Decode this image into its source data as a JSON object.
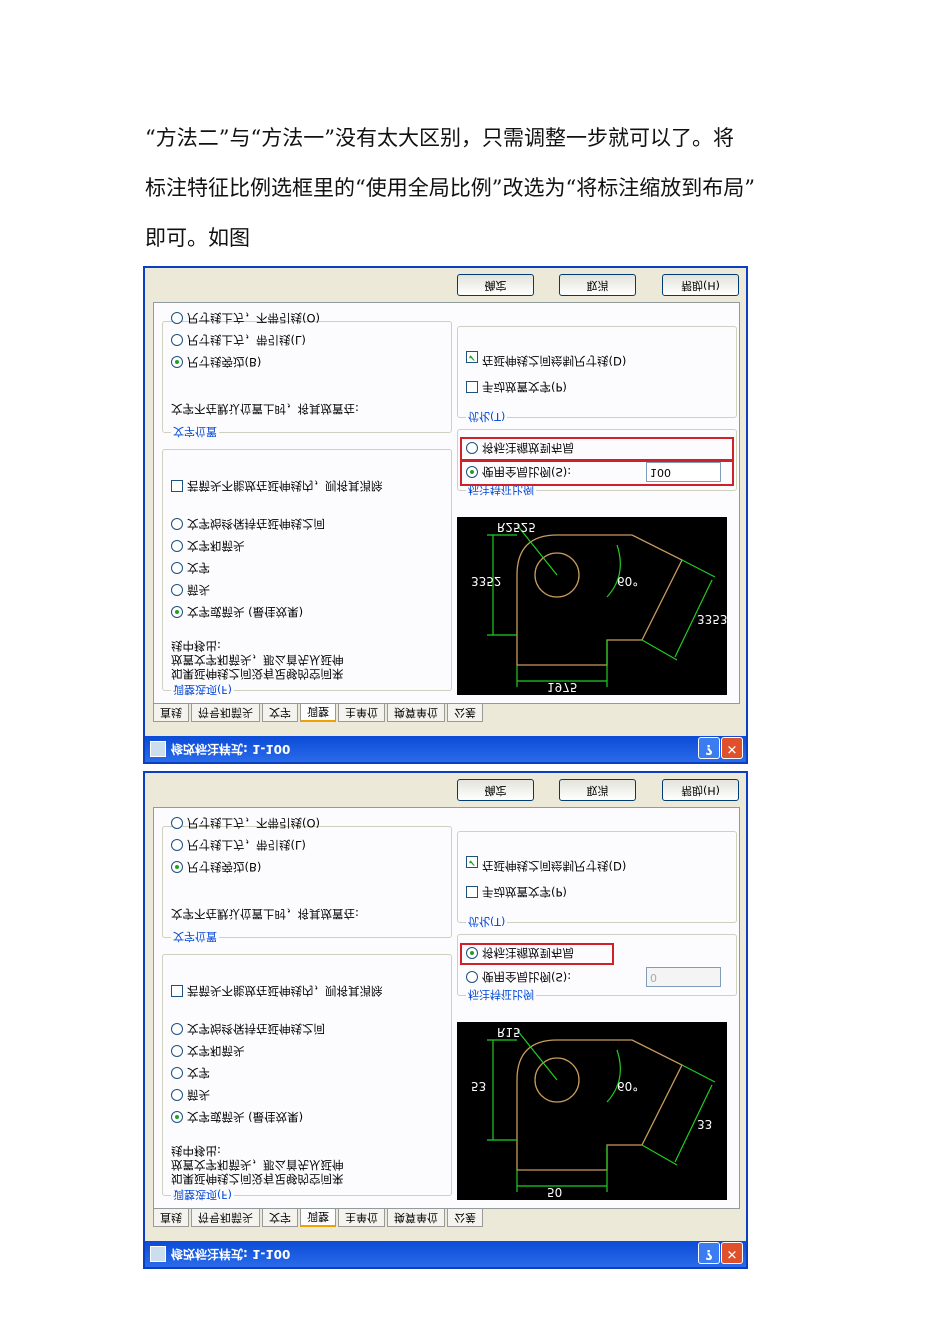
{
  "paragraph": {
    "lines": [
      "“方法二”与“方法一”没有太大区别，只需调整一步就可以了。将",
      "标注特征比例选框里的“使用全局比例”改选为“将标注缩放到布局”",
      "即可。如图"
    ]
  },
  "dialogs": [
    {
      "title": "修改标注样式: 1-100",
      "tabs": [
        "直线",
        "符号和箭头",
        "文字",
        "调整",
        "主单位",
        "换算单位",
        "公差"
      ],
      "active_tab": "调整",
      "fit_options": {
        "title": "调整选项(F)",
        "description": [
          "如果延伸线之间没有足够的空间来",
          "放置文字和箭头，那么首先从延伸",
          "线中移出:"
        ],
        "options": [
          "文字或箭头 (最佳效果)",
          "箭头",
          "文字",
          "文字和箭头",
          "文字始终保持在延伸线之间"
        ],
        "selected": 0,
        "suppress": "若箭头不能放在延伸线内，则将其消除"
      },
      "text_placement": {
        "title": "文字位置",
        "description": "文字不在默认位置上时，将其放置在:",
        "options": [
          "尺寸线旁边(B)",
          "尺寸线上方，带引线(L)",
          "尺寸线上方，不带引线(O)"
        ],
        "selected": 0
      },
      "scale": {
        "title": "标注特征比例",
        "scale_to_layout": "将标注缩放到布局",
        "use_overall": "使用全局比例(S):",
        "value": "100",
        "selected": "overall"
      },
      "fine_tuning": {
        "title": "优化(T)",
        "manual": "手动放置文字(P)",
        "draw_dim": "在延伸线之间绘制尺寸线(D)"
      },
      "preview_labels": {
        "h": "1975",
        "v": "3352",
        "slant": "3353",
        "radius": "R2525",
        "angle": "60°"
      },
      "buttons": {
        "ok": "确定",
        "cancel": "取消",
        "help": "帮助(H)"
      }
    },
    {
      "title": "修改标注样式: 1-100",
      "tabs": [
        "直线",
        "符号和箭头",
        "文字",
        "调整",
        "主单位",
        "换算单位",
        "公差"
      ],
      "active_tab": "调整",
      "fit_options": {
        "title": "调整选项(F)",
        "description": [
          "如果延伸线之间没有足够的空间来",
          "放置文字和箭头，那么首先从延伸",
          "线中移出:"
        ],
        "options": [
          "文字或箭头 (最佳效果)",
          "箭头",
          "文字",
          "文字和箭头",
          "文字始终保持在延伸线之间"
        ],
        "selected": 0,
        "suppress": "若箭头不能放在延伸线内，则将其消除"
      },
      "text_placement": {
        "title": "文字位置",
        "description": "文字不在默认位置上时，将其放置在:",
        "options": [
          "尺寸线旁边(B)",
          "尺寸线上方，带引线(L)",
          "尺寸线上方，不带引线(O)"
        ],
        "selected": 0
      },
      "scale": {
        "title": "标注特征比例",
        "scale_to_layout": "将标注缩放到布局",
        "use_overall": "使用全局比例(S):",
        "value": "0",
        "selected": "layout"
      },
      "fine_tuning": {
        "title": "优化(T)",
        "manual": "手动放置文字(P)",
        "draw_dim": "在延伸线之间绘制尺寸线(D)"
      },
      "preview_labels": {
        "h": "50",
        "v": "53",
        "slant": "33",
        "radius": "R15",
        "angle": "60°"
      },
      "buttons": {
        "ok": "确定",
        "cancel": "取消",
        "help": "帮助(H)"
      }
    }
  ]
}
